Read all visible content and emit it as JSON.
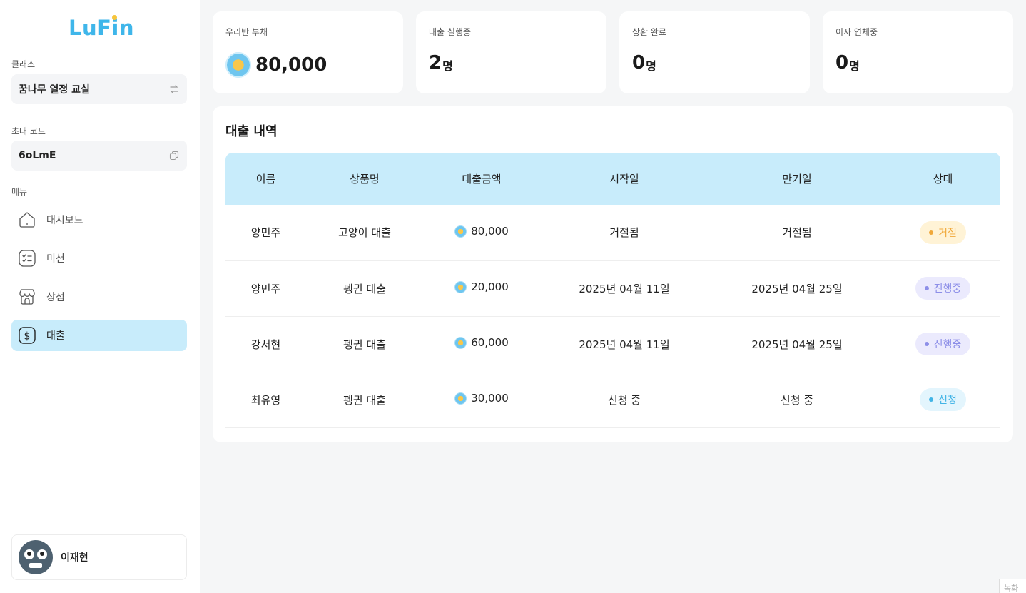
{
  "app": {
    "logo": "LuFin"
  },
  "sidebar": {
    "class_label": "클래스",
    "class_name": "꿈나무 열정 교실",
    "invite_label": "초대 코드",
    "invite_code": "6oLmE",
    "menu_label": "메뉴",
    "menu": [
      {
        "label": "대시보드",
        "icon": "home-icon",
        "active": false
      },
      {
        "label": "미션",
        "icon": "checklist-icon",
        "active": false
      },
      {
        "label": "상점",
        "icon": "store-icon",
        "active": false
      },
      {
        "label": "대출",
        "icon": "dollar-icon",
        "active": true
      }
    ],
    "user_name": "이재현"
  },
  "stats": [
    {
      "label": "우리반 부채",
      "value": "80,000",
      "unit": "",
      "coin": true
    },
    {
      "label": "대출 실행중",
      "value": "2",
      "unit": "명",
      "coin": false
    },
    {
      "label": "상환 완료",
      "value": "0",
      "unit": "명",
      "coin": false
    },
    {
      "label": "이자 연체중",
      "value": "0",
      "unit": "명",
      "coin": false
    }
  ],
  "loans": {
    "title": "대출 내역",
    "columns": [
      "이름",
      "상품명",
      "대출금액",
      "시작일",
      "만기일",
      "상태"
    ],
    "rows": [
      {
        "name": "양민주",
        "product": "고양이 대출",
        "amount": "80,000",
        "start": "거절됨",
        "due": "거절됨",
        "status": "거절",
        "status_kind": "rejected"
      },
      {
        "name": "양민주",
        "product": "펭귄 대출",
        "amount": "20,000",
        "start": "2025년 04월 11일",
        "due": "2025년 04월 25일",
        "status": "진행중",
        "status_kind": "progress"
      },
      {
        "name": "강서현",
        "product": "펭귄 대출",
        "amount": "60,000",
        "start": "2025년 04월 11일",
        "due": "2025년 04월 25일",
        "status": "진행중",
        "status_kind": "progress"
      },
      {
        "name": "최유영",
        "product": "펭귄 대출",
        "amount": "30,000",
        "start": "신청 중",
        "due": "신청 중",
        "status": "신청",
        "status_kind": "applied"
      }
    ]
  },
  "status_colors": {
    "rejected": {
      "bg": "#fff3d6",
      "fg": "#f0a83a"
    },
    "progress": {
      "bg": "#ebeafd",
      "fg": "#8d8fe8"
    },
    "applied": {
      "bg": "#e3f5fd",
      "fg": "#41b4e6"
    }
  },
  "colors": {
    "accent": "#3fb6ea",
    "active_menu_bg": "#c8ecfb",
    "table_header_bg": "#c8ecfb"
  },
  "corner_text": "녹화"
}
